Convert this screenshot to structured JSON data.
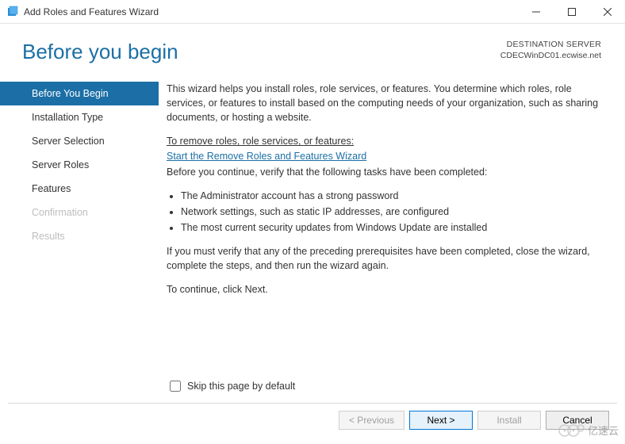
{
  "titlebar": {
    "title": "Add Roles and Features Wizard"
  },
  "header": {
    "page_title": "Before you begin",
    "dest_label": "DESTINATION SERVER",
    "dest_value": "CDECWinDC01.ecwise.net"
  },
  "sidebar": {
    "items": [
      {
        "label": "Before You Begin",
        "state": "active"
      },
      {
        "label": "Installation Type",
        "state": "normal"
      },
      {
        "label": "Server Selection",
        "state": "normal"
      },
      {
        "label": "Server Roles",
        "state": "normal"
      },
      {
        "label": "Features",
        "state": "normal"
      },
      {
        "label": "Confirmation",
        "state": "disabled"
      },
      {
        "label": "Results",
        "state": "disabled"
      }
    ]
  },
  "content": {
    "intro": "This wizard helps you install roles, role services, or features. You determine which roles, role services, or features to install based on the computing needs of your organization, such as sharing documents, or hosting a website.",
    "remove_label": "To remove roles, role services, or features:",
    "remove_link": "Start the Remove Roles and Features Wizard",
    "verify_label": "Before you continue, verify that the following tasks have been completed:",
    "bullets": [
      "The Administrator account has a strong password",
      "Network settings, such as static IP addresses, are configured",
      "The most current security updates from Windows Update are installed"
    ],
    "verify_note": "If you must verify that any of the preceding prerequisites have been completed, close the wizard, complete the steps, and then run the wizard again.",
    "continue_note": "To continue, click Next.",
    "skip_checkbox": "Skip this page by default"
  },
  "buttons": {
    "previous": "< Previous",
    "next": "Next >",
    "install": "Install",
    "cancel": "Cancel"
  },
  "watermark": "亿速云"
}
